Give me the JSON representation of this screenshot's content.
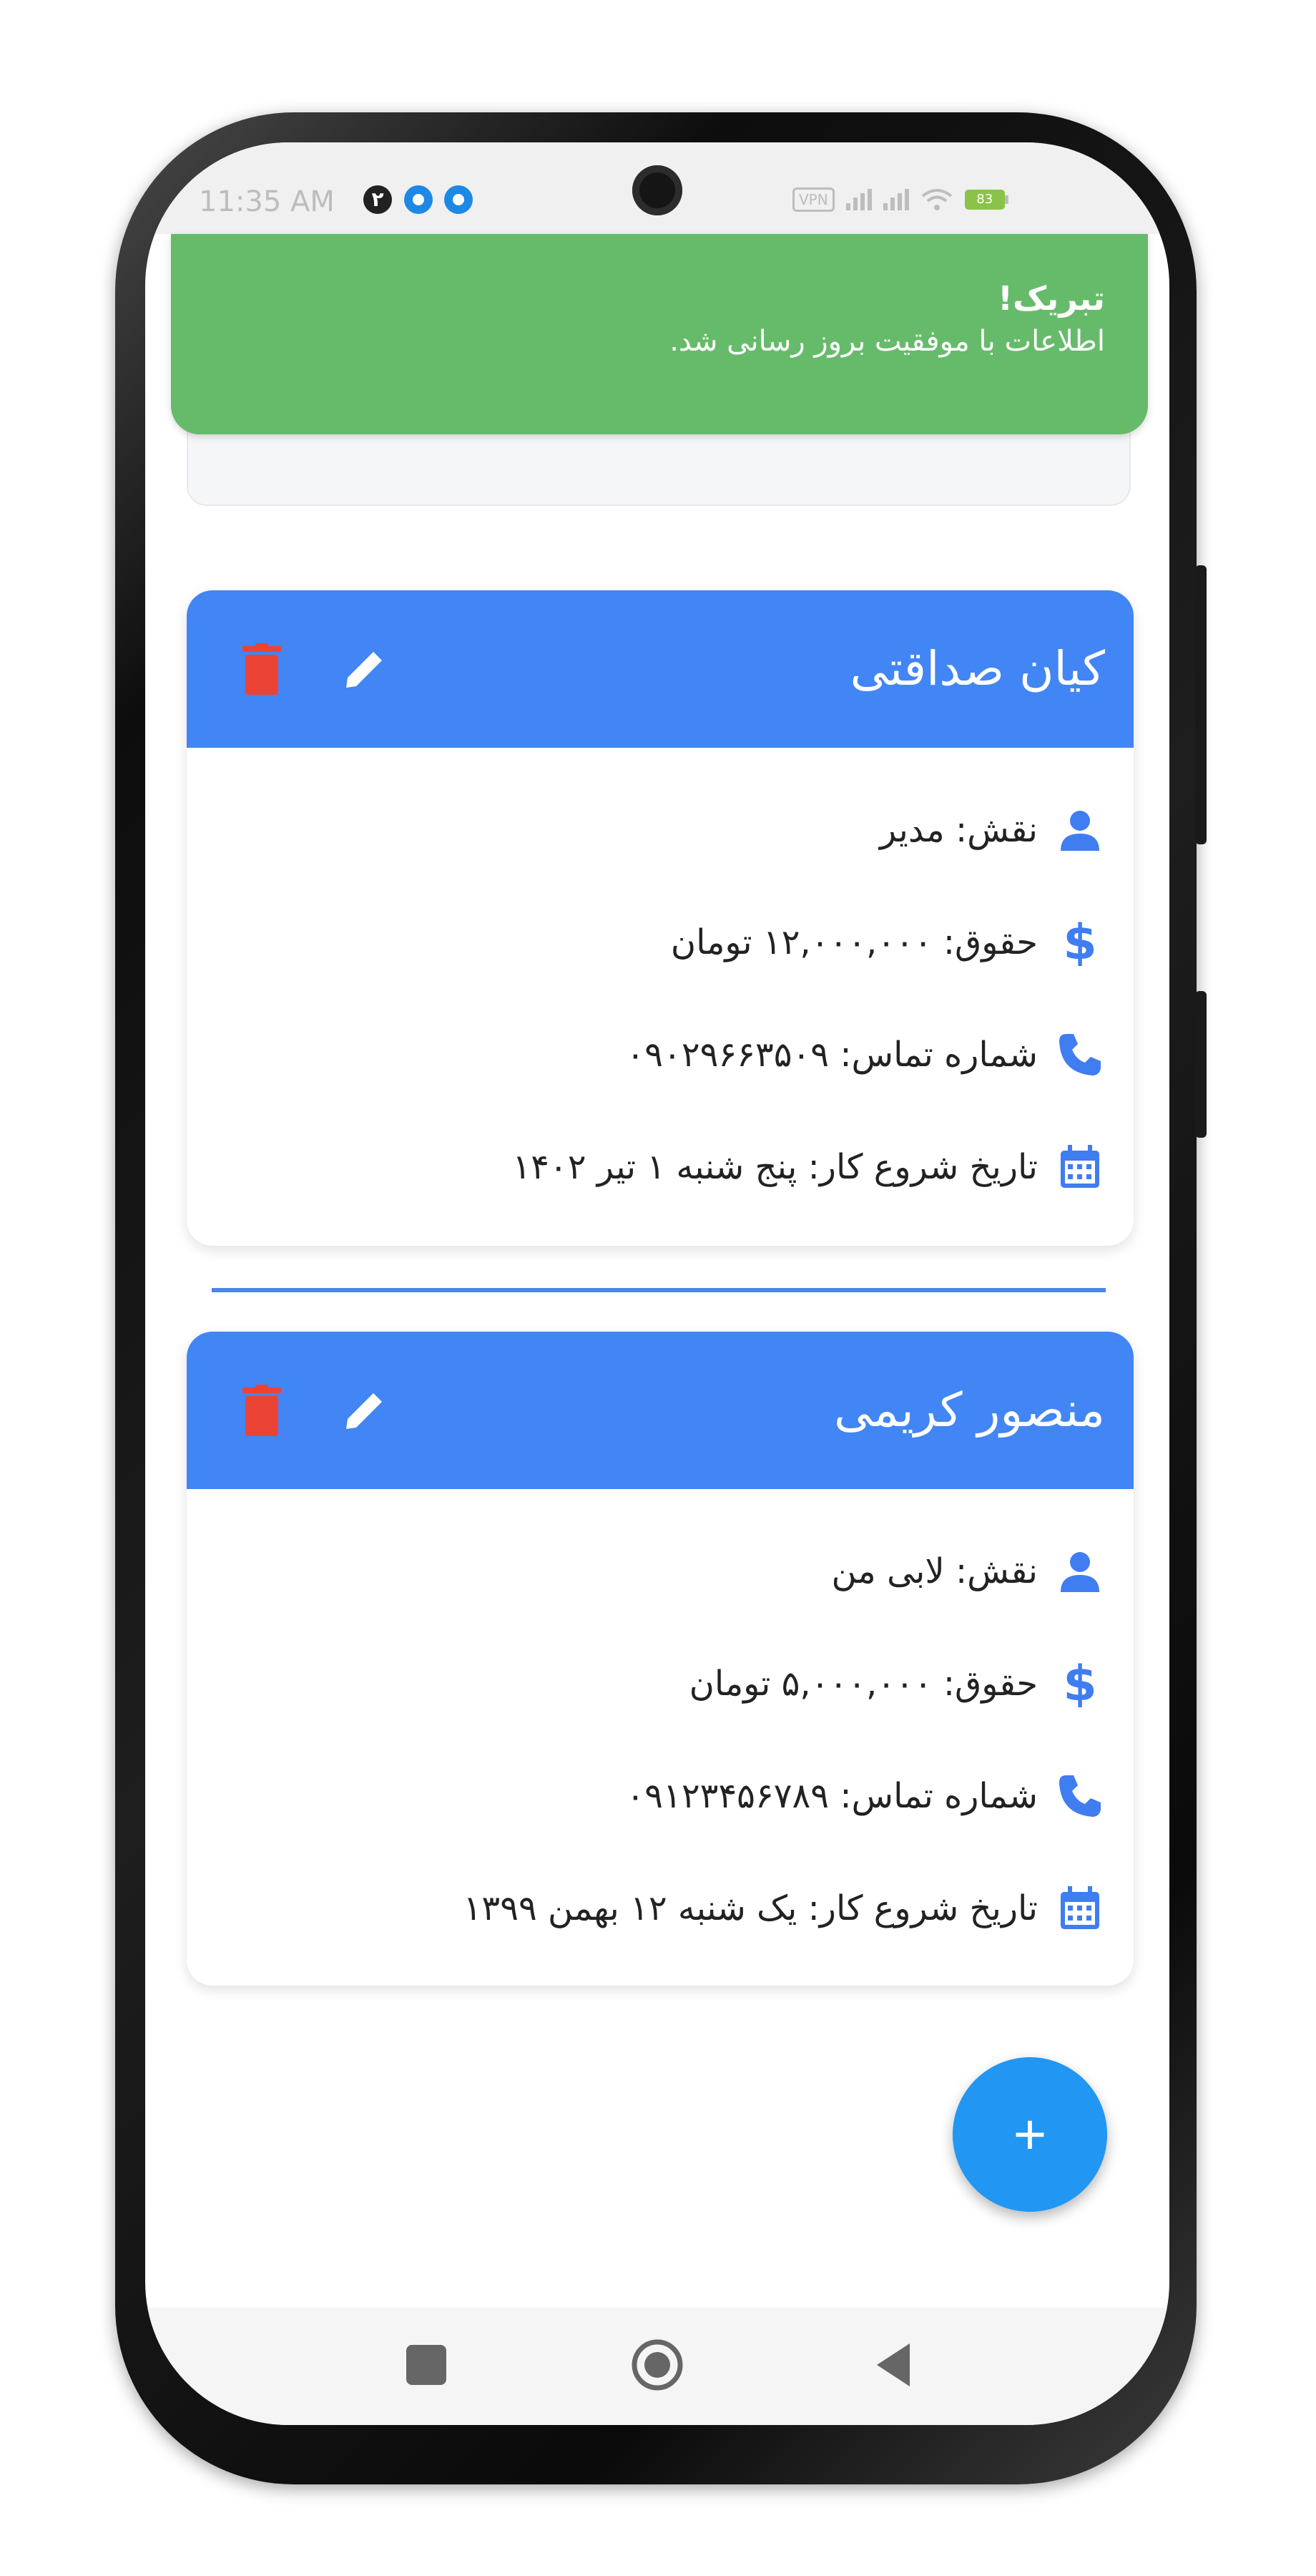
{
  "status_bar": {
    "time": "11:35 AM",
    "notif_badge": "۲",
    "vpn": "VPN",
    "battery": "83"
  },
  "toast": {
    "title": "تبریک!",
    "message": "اطلاعات با موفقیت بروز رسانی شد."
  },
  "employees": [
    {
      "name": "کیان صداقتی",
      "role": "نقش:  مدیر",
      "salary": "حقوق:  ۱۲,۰۰۰,۰۰۰  تومان",
      "phone": "شماره تماس:  ۰۹۰۲۹۶۶۳۵۰۹",
      "start_date": "تاریخ شروع کار: پنج شنبه ۱ تیر ۱۴۰۲"
    },
    {
      "name": "منصور کریمی",
      "role": "نقش:  لابی من",
      "salary": "حقوق:  ۵,۰۰۰,۰۰۰  تومان",
      "phone": "شماره تماس:  ۰۹۱۲۳۴۵۶۷۸۹",
      "start_date": "تاریخ شروع کار: یک شنبه ۱۲ بهمن ۱۳۹۹"
    }
  ],
  "fab": {
    "label": "+"
  },
  "colors": {
    "toast": "#66bb6a",
    "card_header": "#4285f4",
    "delete": "#ea4335",
    "info_icon": "#3f7df0",
    "fab": "#2196f3"
  },
  "icons": {
    "delete": "trash-icon",
    "edit": "pencil-icon",
    "role": "person-icon",
    "salary": "dollar-icon",
    "phone": "phone-icon",
    "date": "calendar-icon"
  }
}
